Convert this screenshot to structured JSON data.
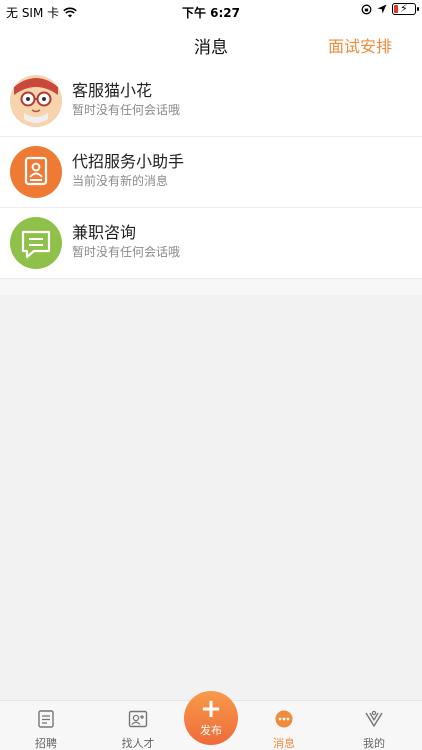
{
  "status": {
    "carrier": "无 SIM 卡",
    "time": "下午 6:27"
  },
  "header": {
    "title": "消息",
    "action": "面试安排"
  },
  "conversations": [
    {
      "name": "客服猫小花",
      "preview": "暂时没有任何会话哦"
    },
    {
      "name": "代招服务小助手",
      "preview": "当前没有新的消息"
    },
    {
      "name": "兼职咨询",
      "preview": "暂时没有任何会话哦"
    }
  ],
  "tabs": [
    {
      "label": "招聘"
    },
    {
      "label": "找人才"
    },
    {
      "label": "发布"
    },
    {
      "label": "消息"
    },
    {
      "label": "我的"
    }
  ],
  "colors": {
    "accent": "#f08a3c",
    "publish": "#ef6b3a",
    "consult": "#8fc04a",
    "assistant": "#ee7a34"
  }
}
